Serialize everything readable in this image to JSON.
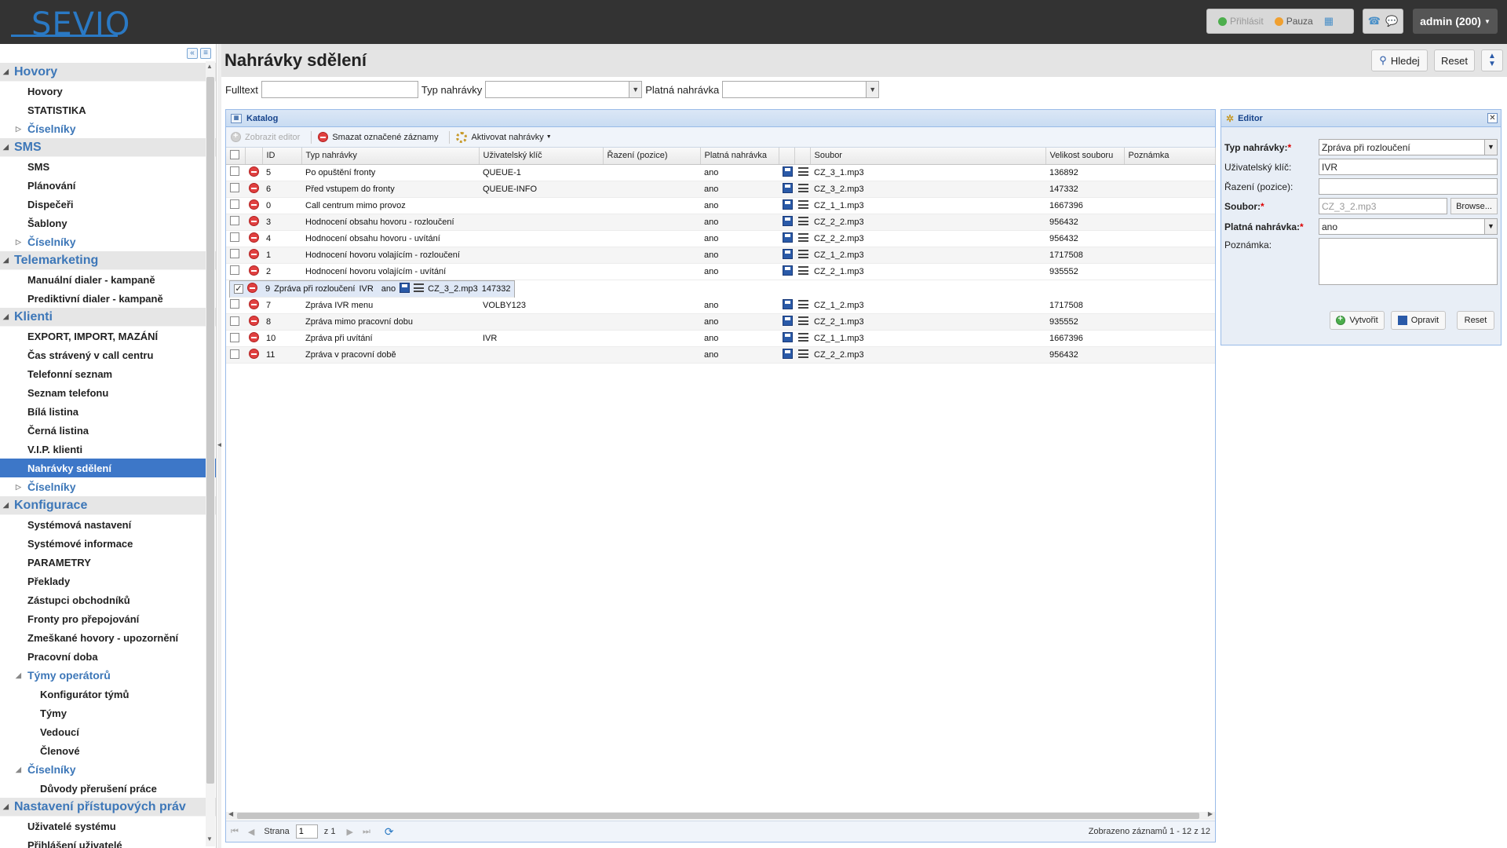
{
  "header": {
    "logo": "SEVIO",
    "login": "Přihlásit",
    "pause": "Pauza",
    "user": "admin (200)",
    "colors": {
      "login_dot": "#4cae4c",
      "pause_dot": "#f0a030",
      "brand": "#2a79c4"
    }
  },
  "sidebar": {
    "sections": [
      {
        "title": "Hovory",
        "items": [
          {
            "label": "Hovory"
          },
          {
            "label": "STATISTIKA"
          },
          {
            "label": "Číselníky",
            "sub": true
          }
        ]
      },
      {
        "title": "SMS",
        "items": [
          {
            "label": "SMS"
          },
          {
            "label": "Plánování"
          },
          {
            "label": "Dispečeři"
          },
          {
            "label": "Šablony"
          },
          {
            "label": "Číselníky",
            "sub": true
          }
        ]
      },
      {
        "title": "Telemarketing",
        "items": [
          {
            "label": "Manuální dialer - kampaně"
          },
          {
            "label": "Prediktivní dialer - kampaně"
          }
        ]
      },
      {
        "title": "Klienti",
        "items": [
          {
            "label": "EXPORT, IMPORT, MAZÁNÍ"
          },
          {
            "label": "Čas strávený v call centru"
          },
          {
            "label": "Telefonní seznam"
          },
          {
            "label": "Seznam telefonu"
          },
          {
            "label": "Bílá listina"
          },
          {
            "label": "Černá listina"
          },
          {
            "label": "V.I.P. klienti"
          },
          {
            "label": "Nahrávky sdělení",
            "active": true
          },
          {
            "label": "Číselníky",
            "sub": true
          }
        ]
      },
      {
        "title": "Konfigurace",
        "items": [
          {
            "label": "Systémová nastavení"
          },
          {
            "label": "Systémové informace"
          },
          {
            "label": "PARAMETRY"
          },
          {
            "label": "Překlady"
          },
          {
            "label": "Zástupci obchodníků"
          },
          {
            "label": "Fronty pro přepojování"
          },
          {
            "label": "Zmeškané hovory - upozornění"
          },
          {
            "label": "Pracovní doba"
          },
          {
            "label": "Týmy operátorů",
            "sub": true,
            "open": true
          },
          {
            "label": "Konfigurátor týmů",
            "l2": true
          },
          {
            "label": "Týmy",
            "l2": true
          },
          {
            "label": "Vedoucí",
            "l2": true
          },
          {
            "label": "Členové",
            "l2": true
          },
          {
            "label": "Číselníky",
            "sub": true,
            "open": true
          },
          {
            "label": "Důvody přerušení práce",
            "l2": true
          }
        ]
      },
      {
        "title": "Nastavení přístupových práv",
        "items": [
          {
            "label": "Uživatelé systému"
          },
          {
            "label": "Přihlášení uživatelé"
          }
        ]
      }
    ]
  },
  "main": {
    "title": "Nahrávky sdělení",
    "search_label": "Hledej",
    "reset_label": "Reset",
    "filters": {
      "fulltext": "Fulltext",
      "type": "Typ nahrávky",
      "valid": "Platná nahrávka"
    }
  },
  "catalog": {
    "title": "Katalog",
    "toolbar": {
      "show_editor": "Zobrazit editor",
      "delete_marked": "Smazat označené záznamy",
      "activate": "Aktivovat nahrávky"
    },
    "columns": [
      "ID",
      "Typ nahrávky",
      "Uživatelský klíč",
      "Řazení (pozice)",
      "Platná nahrávka",
      "Soubor",
      "Velikost souboru",
      "Poznámka"
    ],
    "rows": [
      {
        "id": "5",
        "type": "Po opuštění fronty",
        "key": "QUEUE-1",
        "order": "",
        "valid": "ano",
        "file": "CZ_3_1.mp3",
        "size": "136892",
        "note": ""
      },
      {
        "id": "6",
        "type": "Před vstupem do fronty",
        "key": "QUEUE-INFO",
        "order": "",
        "valid": "ano",
        "file": "CZ_3_2.mp3",
        "size": "147332",
        "note": ""
      },
      {
        "id": "0",
        "type": "Call centrum mimo provoz",
        "key": "",
        "order": "",
        "valid": "ano",
        "file": "CZ_1_1.mp3",
        "size": "1667396",
        "note": ""
      },
      {
        "id": "3",
        "type": "Hodnocení obsahu hovoru - rozloučení",
        "key": "",
        "order": "",
        "valid": "ano",
        "file": "CZ_2_2.mp3",
        "size": "956432",
        "note": ""
      },
      {
        "id": "4",
        "type": "Hodnocení obsahu hovoru - uvítání",
        "key": "",
        "order": "",
        "valid": "ano",
        "file": "CZ_2_2.mp3",
        "size": "956432",
        "note": ""
      },
      {
        "id": "1",
        "type": "Hodnocení hovoru volajícím - rozloučení",
        "key": "",
        "order": "",
        "valid": "ano",
        "file": "CZ_1_2.mp3",
        "size": "1717508",
        "note": ""
      },
      {
        "id": "2",
        "type": "Hodnocení hovoru volajícím - uvítání",
        "key": "",
        "order": "",
        "valid": "ano",
        "file": "CZ_2_1.mp3",
        "size": "935552",
        "note": ""
      },
      {
        "id": "9",
        "type": "Zpráva při rozloučení",
        "key": "IVR",
        "order": "",
        "valid": "ano",
        "file": "CZ_3_2.mp3",
        "size": "147332",
        "note": "",
        "checked": true
      },
      {
        "id": "7",
        "type": "Zpráva IVR menu",
        "key": "VOLBY123",
        "order": "",
        "valid": "ano",
        "file": "CZ_1_2.mp3",
        "size": "1717508",
        "note": ""
      },
      {
        "id": "8",
        "type": "Zpráva mimo pracovní dobu",
        "key": "",
        "order": "",
        "valid": "ano",
        "file": "CZ_2_1.mp3",
        "size": "935552",
        "note": ""
      },
      {
        "id": "10",
        "type": "Zpráva při uvítání",
        "key": "IVR",
        "order": "",
        "valid": "ano",
        "file": "CZ_1_1.mp3",
        "size": "1667396",
        "note": ""
      },
      {
        "id": "11",
        "type": "Zpráva v pracovní době",
        "key": "",
        "order": "",
        "valid": "ano",
        "file": "CZ_2_2.mp3",
        "size": "956432",
        "note": ""
      }
    ],
    "pager": {
      "page_label": "Strana",
      "page": "1",
      "of": "z 1",
      "info": "Zobrazeno záznamů 1 - 12 z 12"
    }
  },
  "editor": {
    "title": "Editor",
    "fields": {
      "type_label": "Typ nahrávky:",
      "type_value": "Zpráva při rozloučení",
      "key_label": "Uživatelský klíč:",
      "key_value": "IVR",
      "order_label": "Řazení (pozice):",
      "order_value": "",
      "file_label": "Soubor:",
      "file_value": "CZ_3_2.mp3",
      "browse": "Browse...",
      "valid_label": "Platná nahrávka:",
      "valid_value": "ano",
      "note_label": "Poznámka:"
    },
    "buttons": {
      "create": "Vytvořit",
      "edit": "Opravit",
      "reset": "Reset"
    }
  }
}
